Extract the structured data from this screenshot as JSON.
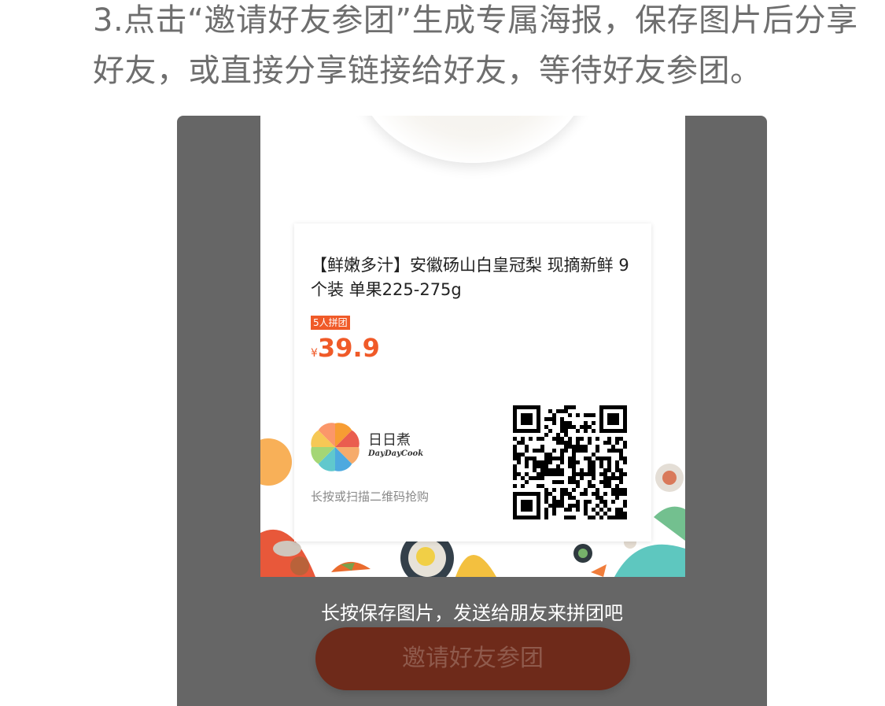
{
  "instruction": "3.点击“邀请好友参团”生成专属海报，保存图片后分享好友，或直接分享链接给好友，等待好友参团。",
  "poster": {
    "product_title": "【鲜嫩多汁】安徽砀山白皇冠梨 现摘新鲜 9个装 单果225-275g",
    "group_tag": "5人拼团",
    "currency": "¥",
    "price": "39.9",
    "brand_name": "日日煮",
    "brand_sub": "DayDayCook",
    "scan_hint": "长按或扫描二维码抢购",
    "qr_icon": "qr-code-icon",
    "brand_colors": [
      "#f7931e",
      "#e84c3d",
      "#4fc3c8",
      "#9bd267",
      "#3aa0dc",
      "#f6c343"
    ]
  },
  "save_tip": "长按保存图片，发送给朋友来拼团吧",
  "invite_button": "邀请好友参团",
  "colors": {
    "accent": "#f05a28",
    "overlay": "#666666",
    "button": "#6e2a1a"
  }
}
